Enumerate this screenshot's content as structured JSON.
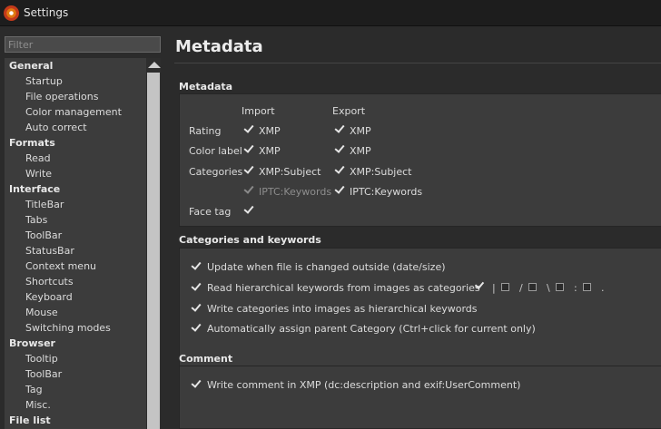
{
  "window": {
    "title": "Settings"
  },
  "sidebar": {
    "filter_placeholder": "Filter",
    "items": [
      {
        "label": "General",
        "type": "cat"
      },
      {
        "label": "Startup",
        "type": "sub"
      },
      {
        "label": "File operations",
        "type": "sub"
      },
      {
        "label": "Color management",
        "type": "sub"
      },
      {
        "label": "Auto correct",
        "type": "sub"
      },
      {
        "label": "Formats",
        "type": "cat"
      },
      {
        "label": "Read",
        "type": "sub"
      },
      {
        "label": "Write",
        "type": "sub"
      },
      {
        "label": "Interface",
        "type": "cat"
      },
      {
        "label": "TitleBar",
        "type": "sub"
      },
      {
        "label": "Tabs",
        "type": "sub"
      },
      {
        "label": "ToolBar",
        "type": "sub"
      },
      {
        "label": "StatusBar",
        "type": "sub"
      },
      {
        "label": "Context menu",
        "type": "sub"
      },
      {
        "label": "Shortcuts",
        "type": "sub"
      },
      {
        "label": "Keyboard",
        "type": "sub"
      },
      {
        "label": "Mouse",
        "type": "sub"
      },
      {
        "label": "Switching modes",
        "type": "sub"
      },
      {
        "label": "Browser",
        "type": "cat"
      },
      {
        "label": "Tooltip",
        "type": "sub"
      },
      {
        "label": "ToolBar",
        "type": "sub"
      },
      {
        "label": "Tag",
        "type": "sub"
      },
      {
        "label": "Misc.",
        "type": "sub"
      },
      {
        "label": "File list",
        "type": "cat"
      }
    ]
  },
  "main": {
    "title": "Metadata",
    "metadata": {
      "heading": "Metadata",
      "col_import": "Import",
      "col_export": "Export",
      "rows": [
        {
          "label": "Rating",
          "import": "XMP",
          "export": "XMP"
        },
        {
          "label": "Color label",
          "import": "XMP",
          "export": "XMP"
        },
        {
          "label": "Categories",
          "import": "XMP:Subject",
          "export": "XMP:Subject"
        },
        {
          "label": "",
          "import": "IPTC:Keywords",
          "export": "IPTC:Keywords"
        },
        {
          "label": "Face tag"
        }
      ]
    },
    "categories": {
      "heading": "Categories and keywords",
      "options": [
        "Update when file is changed outside (date/size)",
        "Read hierarchical keywords from images as categories",
        "Write categories into images as hierarchical keywords",
        "Automatically assign parent Category (Ctrl+click for current only)"
      ],
      "separators": [
        "|",
        "/",
        "\\",
        ":",
        "."
      ]
    },
    "comment": {
      "heading": "Comment",
      "option": "Write comment in XMP (dc:description and exif:UserComment)"
    }
  }
}
